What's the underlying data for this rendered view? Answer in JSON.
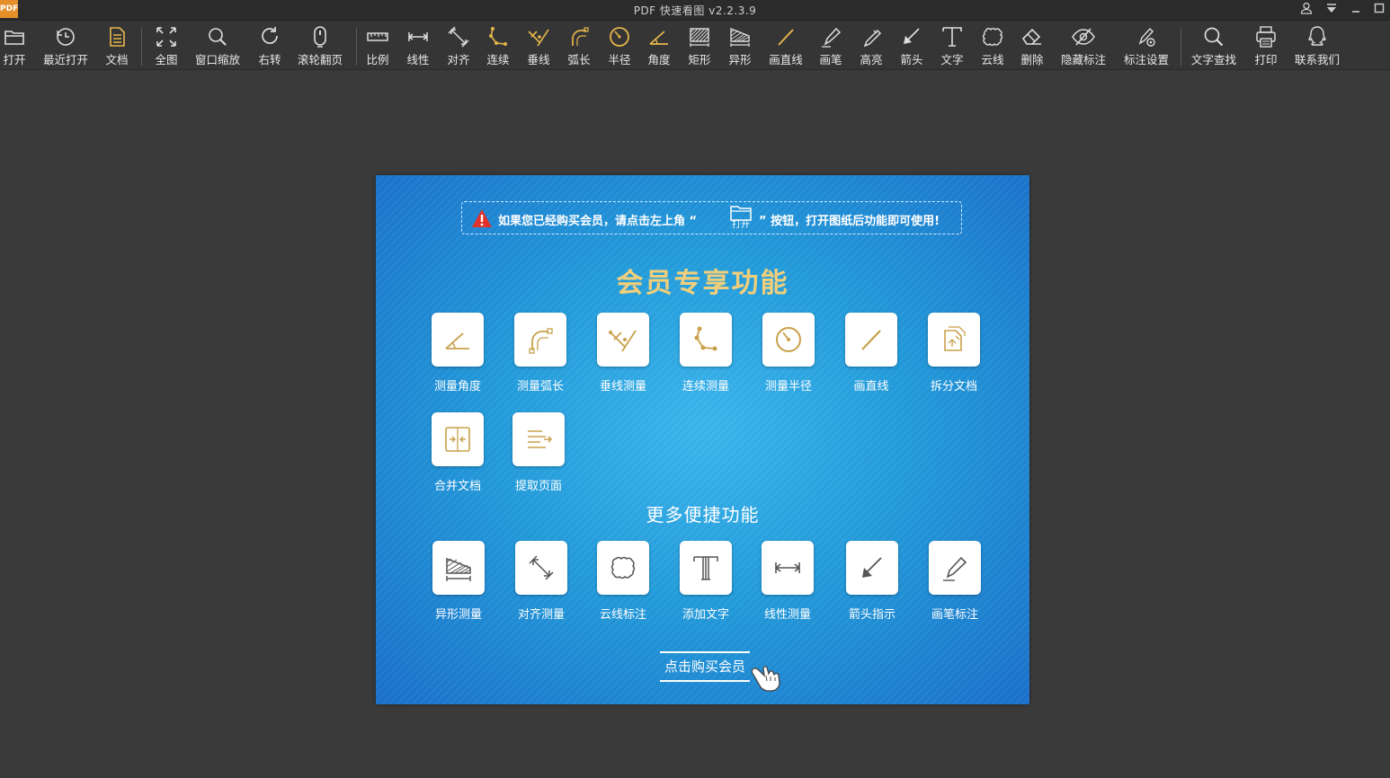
{
  "window": {
    "title": "PDF 快速看图 v2.2.3.9",
    "logo_text": "PDF"
  },
  "toolbar": {
    "items": [
      {
        "label": "打开",
        "icon": "folder-open-icon"
      },
      {
        "label": "最近打开",
        "icon": "recent-clock-icon"
      },
      {
        "label": "文档",
        "icon": "document-icon"
      },
      {
        "label": "全图",
        "icon": "fit-all-icon"
      },
      {
        "label": "窗口缩放",
        "icon": "magnifier-icon"
      },
      {
        "label": "右转",
        "icon": "rotate-right-icon"
      },
      {
        "label": "滚轮翻页",
        "icon": "mouse-wheel-icon"
      },
      {
        "label": "比例",
        "icon": "scale-ruler-icon"
      },
      {
        "label": "线性",
        "icon": "linear-measure-icon"
      },
      {
        "label": "对齐",
        "icon": "align-measure-icon"
      },
      {
        "label": "连续",
        "icon": "continuous-measure-icon"
      },
      {
        "label": "垂线",
        "icon": "perpendicular-icon"
      },
      {
        "label": "弧长",
        "icon": "arc-length-icon"
      },
      {
        "label": "半径",
        "icon": "radius-icon"
      },
      {
        "label": "角度",
        "icon": "angle-icon"
      },
      {
        "label": "矩形",
        "icon": "rectangle-area-icon"
      },
      {
        "label": "异形",
        "icon": "irregular-area-icon"
      },
      {
        "label": "画直线",
        "icon": "draw-line-icon"
      },
      {
        "label": "画笔",
        "icon": "pen-icon"
      },
      {
        "label": "高亮",
        "icon": "highlighter-icon"
      },
      {
        "label": "箭头",
        "icon": "arrow-icon"
      },
      {
        "label": "文字",
        "icon": "text-icon"
      },
      {
        "label": "云线",
        "icon": "cloud-line-icon"
      },
      {
        "label": "删除",
        "icon": "eraser-icon"
      },
      {
        "label": "隐藏标注",
        "icon": "eye-hidden-icon"
      },
      {
        "label": "标注设置",
        "icon": "annotation-settings-icon"
      },
      {
        "label": "文字查找",
        "icon": "text-search-icon"
      },
      {
        "label": "打印",
        "icon": "printer-icon"
      },
      {
        "label": "联系我们",
        "icon": "contact-qq-icon"
      }
    ]
  },
  "panel": {
    "notice_before": "如果您已经购买会员，请点击左上角 “",
    "notice_folder_label": "打开",
    "notice_after": "” 按钮，打开图纸后功能即可使用!",
    "member_title": "会员专享功能",
    "member_features": [
      {
        "label": "测量角度",
        "icon": "angle-icon"
      },
      {
        "label": "测量弧长",
        "icon": "arc-length-icon"
      },
      {
        "label": "垂线测量",
        "icon": "perpendicular-icon"
      },
      {
        "label": "连续测量",
        "icon": "continuous-measure-icon"
      },
      {
        "label": "测量半径",
        "icon": "radius-icon"
      },
      {
        "label": "画直线",
        "icon": "draw-line-icon"
      },
      {
        "label": "拆分文档",
        "icon": "split-document-icon"
      },
      {
        "label": "合并文档",
        "icon": "merge-document-icon"
      },
      {
        "label": "提取页面",
        "icon": "extract-page-icon"
      }
    ],
    "more_title": "更多便捷功能",
    "more_features": [
      {
        "label": "异形测量",
        "icon": "irregular-area-icon"
      },
      {
        "label": "对齐测量",
        "icon": "align-measure-icon"
      },
      {
        "label": "云线标注",
        "icon": "cloud-line-icon"
      },
      {
        "label": "添加文字",
        "icon": "text-icon"
      },
      {
        "label": "线性测量",
        "icon": "linear-measure-icon"
      },
      {
        "label": "箭头指示",
        "icon": "arrow-icon"
      },
      {
        "label": "画笔标注",
        "icon": "pen-icon"
      }
    ],
    "buy_label": "点击购买会员"
  },
  "colors": {
    "accent_gold": "#e6b54a",
    "member_title": "#f1cf7a",
    "panel_blue": "#229ad9",
    "warning_red": "#e0322b"
  }
}
